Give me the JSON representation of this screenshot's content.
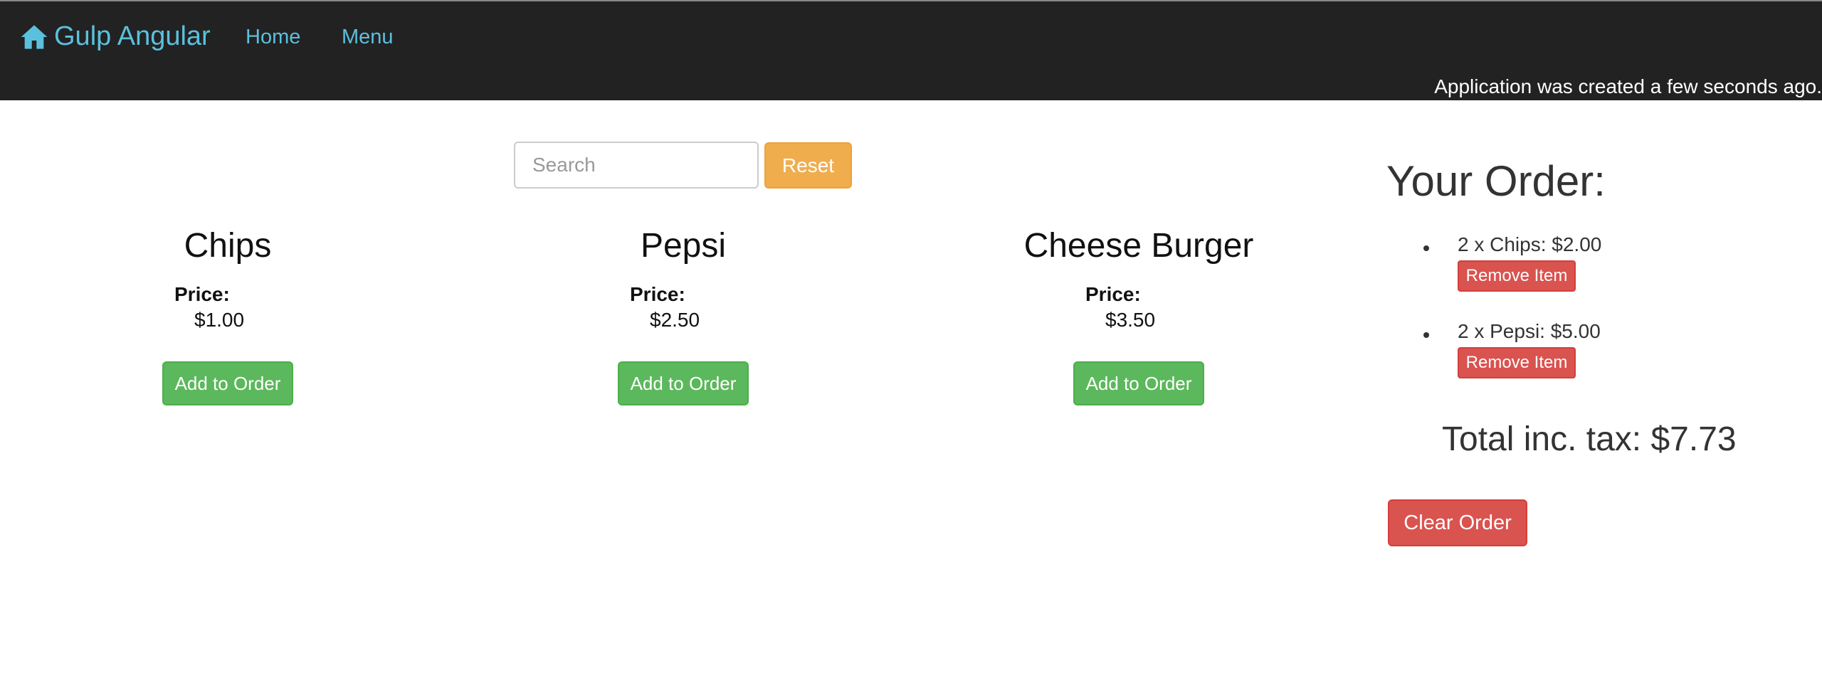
{
  "navbar": {
    "brand": "Gulp Angular",
    "links": [
      "Home",
      "Menu"
    ],
    "status_text": "Application was created a few seconds ago."
  },
  "search": {
    "placeholder": "Search",
    "value": "",
    "reset_label": "Reset"
  },
  "products": [
    {
      "name": "Chips",
      "price_label": "Price:",
      "price": "$1.00",
      "button": "Add to Order"
    },
    {
      "name": "Pepsi",
      "price_label": "Price:",
      "price": "$2.50",
      "button": "Add to Order"
    },
    {
      "name": "Cheese Burger",
      "price_label": "Price:",
      "price": "$3.50",
      "button": "Add to Order"
    }
  ],
  "order": {
    "title": "Your Order:",
    "items": [
      {
        "text": "2 x Chips: $2.00",
        "button": "Remove Item"
      },
      {
        "text": "2 x Pepsi: $5.00",
        "button": "Remove Item"
      }
    ],
    "total": "Total inc. tax: $7.73",
    "clear_label": "Clear Order"
  },
  "colors": {
    "navbar_bg": "#222222",
    "link": "#5bc0de",
    "success": "#5cb85c",
    "warning": "#f0ad4e",
    "danger": "#d9534f"
  },
  "icons": {
    "brand": "home-icon"
  }
}
